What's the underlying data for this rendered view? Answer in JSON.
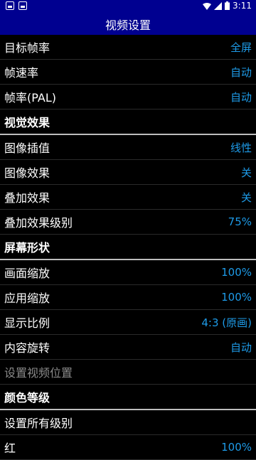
{
  "status": {
    "time": "3:11",
    "icons": [
      "image-icon",
      "text-icon",
      "wifi-icon",
      "signal-icon",
      "battery-icon"
    ]
  },
  "appbar": {
    "title": "视频设置"
  },
  "items": [
    {
      "type": "row",
      "label": "目标帧率",
      "value": "全屏",
      "name": "target-framerate"
    },
    {
      "type": "row",
      "label": "帧速率",
      "value": "自动",
      "name": "frame-speed"
    },
    {
      "type": "row",
      "label": "帧率(PAL)",
      "value": "自动",
      "name": "framerate-pal"
    },
    {
      "type": "section",
      "label": "视觉效果",
      "name": "visual-effects"
    },
    {
      "type": "row",
      "label": "图像插值",
      "value": "线性",
      "name": "image-interpolation"
    },
    {
      "type": "row",
      "label": "图像效果",
      "value": "关",
      "name": "image-effect"
    },
    {
      "type": "row",
      "label": "叠加效果",
      "value": "关",
      "name": "overlay-effect"
    },
    {
      "type": "row",
      "label": "叠加效果级别",
      "value": "75%",
      "name": "overlay-level"
    },
    {
      "type": "section",
      "label": "屏幕形状",
      "name": "screen-shape"
    },
    {
      "type": "row",
      "label": "画面缩放",
      "value": "100%",
      "name": "frame-scale"
    },
    {
      "type": "row",
      "label": "应用缩放",
      "value": "100%",
      "name": "app-scale"
    },
    {
      "type": "row",
      "label": "显示比例",
      "value": "4:3 (原画)",
      "name": "aspect-ratio"
    },
    {
      "type": "row",
      "label": "内容旋转",
      "value": "自动",
      "name": "content-rotation"
    },
    {
      "type": "row",
      "label": "设置视频位置",
      "value": "",
      "disabled": true,
      "name": "video-position"
    },
    {
      "type": "section",
      "label": "颜色等级",
      "name": "color-levels"
    },
    {
      "type": "row",
      "label": "设置所有级别",
      "value": "",
      "name": "set-all-levels"
    },
    {
      "type": "row",
      "label": "红",
      "value": "100%",
      "name": "red-level"
    }
  ],
  "colors": {
    "accent": "#1e9be8",
    "appbar": "#000090",
    "background": "#000000"
  }
}
